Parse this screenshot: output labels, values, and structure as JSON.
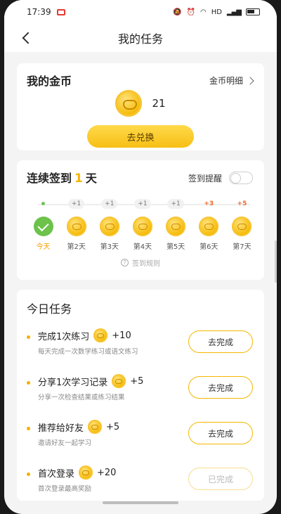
{
  "status_bar": {
    "time": "17:39",
    "network": "HD"
  },
  "nav": {
    "title": "我的任务"
  },
  "coins": {
    "title": "我的金币",
    "detail_link": "金币明细",
    "count": "21",
    "exchange_button": "去兑换"
  },
  "signin": {
    "title_prefix": "连续签到",
    "days": "1",
    "title_suffix": "天",
    "reminder_label": "签到提醒",
    "reminder_on": false,
    "bonuses": [
      "",
      "+1",
      "+1",
      "+1",
      "+1",
      "+3",
      "+5"
    ],
    "days_labels": [
      "今天",
      "第2天",
      "第3天",
      "第4天",
      "第5天",
      "第6天",
      "第7天"
    ],
    "rules_link": "签到规则"
  },
  "tasks": {
    "title": "今日任务",
    "items": [
      {
        "name": "完成1次练习",
        "reward": "+10",
        "desc": "每天完成一次数学练习或语文练习",
        "button": "去完成",
        "done": false
      },
      {
        "name": "分享1次学习记录",
        "reward": "+5",
        "desc": "分享一次检查结果或练习结果",
        "button": "去完成",
        "done": false
      },
      {
        "name": "推荐给好友",
        "reward": "+5",
        "desc": "邀请好友一起学习",
        "button": "去完成",
        "done": false
      },
      {
        "name": "首次登录",
        "reward": "+20",
        "desc": "首次登录最高奖励",
        "button": "已完成",
        "done": true
      }
    ]
  },
  "colors": {
    "accent": "#f7bf16",
    "check_green": "#6cc24a",
    "hot_bonus": "#ef6a28"
  },
  "icons": {
    "back": "chevron-left-icon",
    "detail": "chevron-right-icon",
    "coin": "coin-icon",
    "rules": "question-circle-icon"
  }
}
